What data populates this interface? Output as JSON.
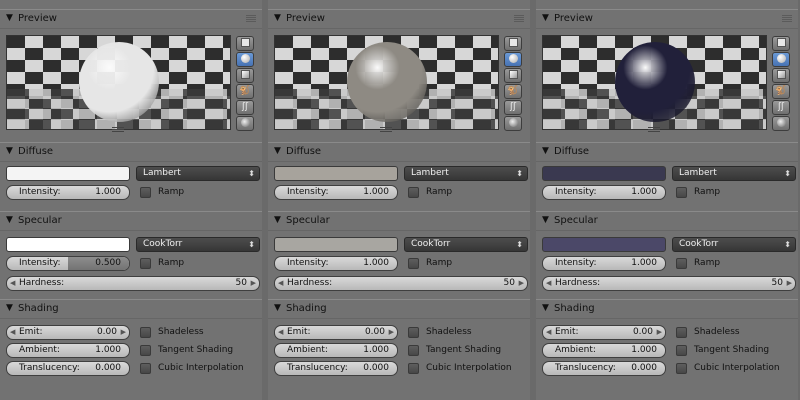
{
  "panels": {
    "preview": "Preview",
    "diffuse": "Diffuse",
    "specular": "Specular",
    "shading": "Shading"
  },
  "labels": {
    "lambert": "Lambert",
    "cooktorr": "CookTorr",
    "intensity": "Intensity:",
    "ramp": "Ramp",
    "hardness": "Hardness:",
    "emit": "Emit:",
    "ambient": "Ambient:",
    "translucency": "Translucency:",
    "shadeless": "Shadeless",
    "tangent_shading": "Tangent Shading",
    "cubic_interpolation": "Cubic Interpolation"
  },
  "icons": [
    "flat-icon",
    "sphere-icon",
    "cube-icon",
    "monkey-icon",
    "hair-icon",
    "sphere-sky-icon"
  ],
  "materials": [
    {
      "sphere_color": "#e6e6e6",
      "diffuse_color": "#f4f4f4",
      "diffuse_intensity": "1.000",
      "specular_color": "#ffffff",
      "specular_intensity": "0.500",
      "specular_intensity_fraction": 0.5,
      "hardness": "50",
      "emit": "0.00",
      "ambient": "1.000",
      "translucency": "0.000"
    },
    {
      "sphere_color": "#8e8a83",
      "diffuse_color": "#a7a39c",
      "diffuse_intensity": "1.000",
      "specular_color": "#a8a6a1",
      "specular_intensity": "1.000",
      "specular_intensity_fraction": 1.0,
      "hardness": "50",
      "emit": "0.00",
      "ambient": "1.000",
      "translucency": "0.000"
    },
    {
      "sphere_color": "#21203a",
      "diffuse_color": "#3a3950",
      "diffuse_intensity": "1.000",
      "specular_color": "#4b4868",
      "specular_intensity": "1.000",
      "specular_intensity_fraction": 1.0,
      "hardness": "50",
      "emit": "0.00",
      "ambient": "1.000",
      "translucency": "0.000"
    }
  ]
}
